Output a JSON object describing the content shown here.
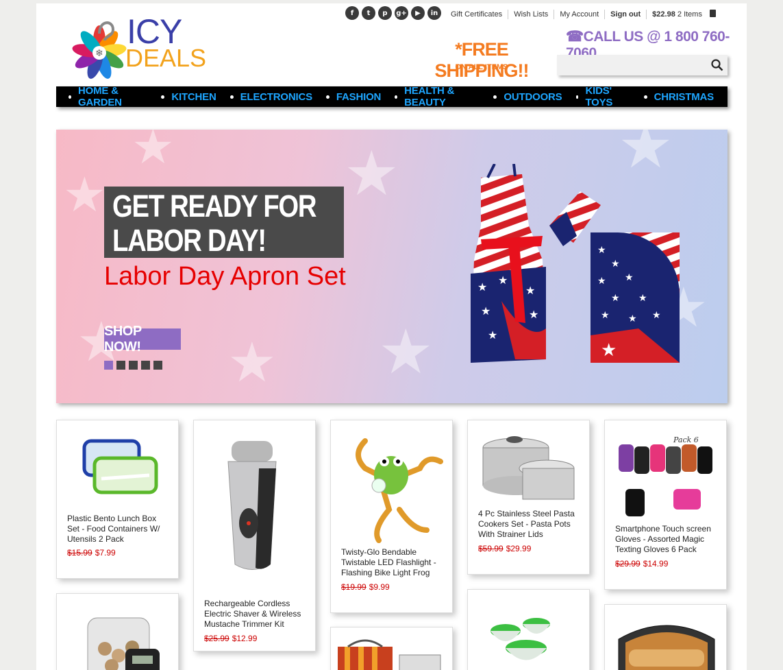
{
  "header": {
    "logo_line1": "ICY",
    "logo_line2": "DEALS",
    "social_icons": [
      "facebook-icon",
      "twitter-icon",
      "pinterest-icon",
      "google-plus-icon",
      "youtube-icon",
      "linkedin-icon"
    ],
    "links": {
      "gift": "Gift Certificates",
      "wish": "Wish Lists",
      "account": "My Account",
      "signout": "Sign out",
      "cart_total": "$22.98",
      "cart_items": "2 Items"
    },
    "call_us": "☎CALL US @ 1 800 760-7060",
    "free_shipping": "*FREE SHIPPING!!",
    "free_shipping_sub": "ON ALL ITEMS",
    "search_placeholder": ""
  },
  "nav": {
    "items": [
      "HOME & GARDEN",
      "KITCHEN",
      "ELECTRONICS",
      "FASHION",
      "HEALTH & BEAUTY",
      "OUTDOORS",
      "KIDS' TOYS",
      "CHRISTMAS"
    ]
  },
  "banner": {
    "headline_1": "GET READY FOR",
    "headline_2": "LABOR DAY!",
    "product": "Labor Day Apron Set",
    "cta": "SHOP NOW!",
    "slides": 5,
    "active_slide": 1
  },
  "products": [
    {
      "title": "Plastic Bento Lunch Box Set - Food Containers W/ Utensils 2 Pack",
      "old_price": "$15.99",
      "new_price": "$7.99"
    },
    {
      "title": "Rechargeable Cordless Electric Shaver & Wireless Mustache Trimmer Kit",
      "old_price": "$25.99",
      "new_price": "$12.99"
    },
    {
      "title": "Twisty-Glo Bendable Twistable LED Flashlight - Flashing Bike Light Frog",
      "old_price": "$19.99",
      "new_price": "$9.99"
    },
    {
      "title": "4 Pc Stainless Steel Pasta Cookers Set - Pasta Pots With Strainer Lids",
      "old_price": "$59.99",
      "new_price": "$29.99"
    },
    {
      "title": "Smartphone Touch screen Gloves - Assorted Magic Texting Gloves 6 Pack",
      "old_price": "$29.99",
      "new_price": "$14.99",
      "img_label": "Pack 6"
    }
  ]
}
